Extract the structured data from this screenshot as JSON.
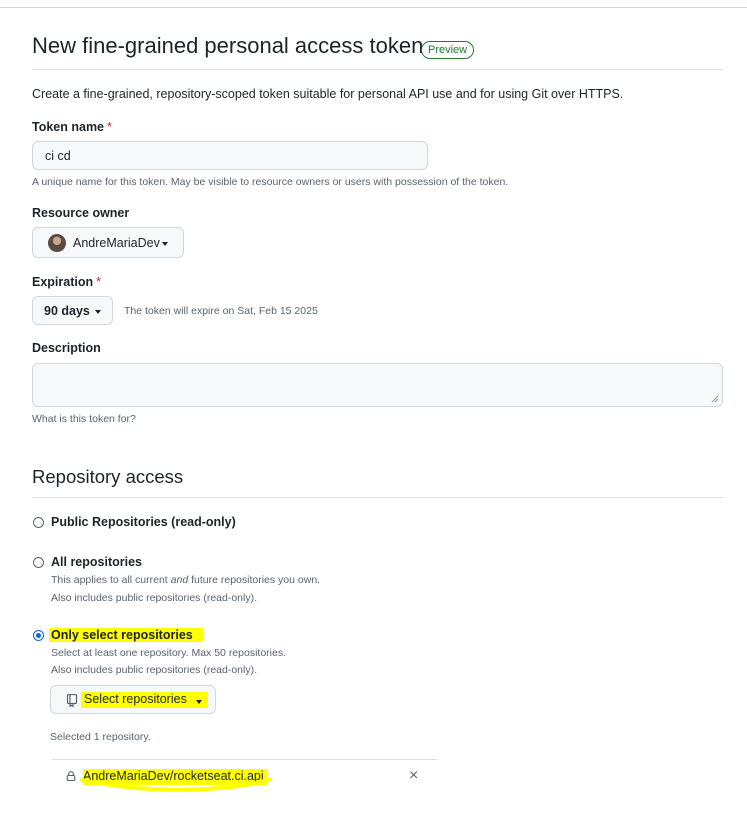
{
  "page": {
    "title": "New fine-grained personal access token",
    "badge": "Preview",
    "subtitle": "Create a fine-grained, repository-scoped token suitable for personal API use and for using Git over HTTPS."
  },
  "token_name": {
    "label": "Token name",
    "required_mark": "*",
    "value": "ci cd",
    "note": "A unique name for this token. May be visible to resource owners or users with possession of the token."
  },
  "resource_owner": {
    "label": "Resource owner",
    "selected": "AndreMariaDev"
  },
  "expiration": {
    "label": "Expiration",
    "required_mark": "*",
    "selected": "90 days",
    "note": "The token will expire on Sat, Feb 15 2025"
  },
  "description": {
    "label": "Description",
    "value": "",
    "note": "What is this token for?"
  },
  "repository_access": {
    "title": "Repository access",
    "options": [
      {
        "label": "Public Repositories (read-only)",
        "checked": false,
        "lines": []
      },
      {
        "label": "All repositories",
        "checked": false,
        "line1_pre": "This applies to all current ",
        "line1_em": "and",
        "line1_post": " future repositories you own.",
        "line2": "Also includes public repositories (read-only)."
      },
      {
        "label": "Only select repositories",
        "checked": true,
        "line1": "Select at least one repository. Max 50 repositories.",
        "line2": "Also includes public repositories (read-only)."
      }
    ],
    "select_button": "Select repositories",
    "selected_count": "Selected 1 repository.",
    "selected_repos": [
      {
        "owner_prefix": "AndreMariaDev/",
        "name": "rocketseat.ci.api"
      }
    ]
  },
  "colors": {
    "highlight": "#ffff00",
    "accent": "#0969da",
    "badge_green": "#1a7f37",
    "required_red": "#d1242f"
  }
}
